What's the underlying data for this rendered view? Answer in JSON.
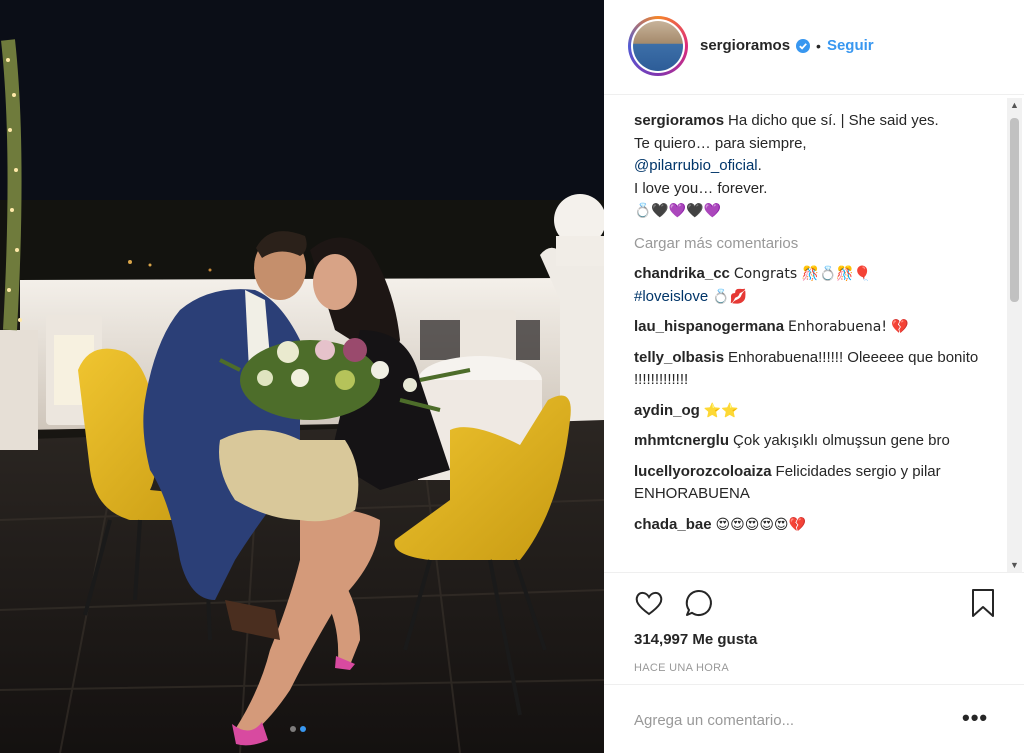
{
  "header": {
    "username": "sergioramos",
    "separator": "•",
    "follow_label": "Seguir",
    "avatar_icon": "profile-avatar",
    "verified_icon": "verified-badge-icon"
  },
  "caption": {
    "username": "sergioramos",
    "line1": "Ha dicho que sí. | She said yes.",
    "line2": "Te quiero… para siempre,",
    "mention": "@pilarrubio_oficial",
    "line3_end": ".",
    "line4": "I love you… forever.",
    "emojis": "💍🖤💜🖤💜"
  },
  "load_more": "Cargar más comentarios",
  "comments": [
    {
      "user": "chandrika_cc",
      "text": "Congrats 🎊💍🎊🎈",
      "hashtag": "#loveislove",
      "suffix": "💍💋"
    },
    {
      "user": "lau_hispanogermana",
      "text": "Enhorabuena! 💔"
    },
    {
      "user": "telly_olbasis",
      "text": "Enhorabuena!!!!!! Oleeeee que bonito !!!!!!!!!!!!!"
    },
    {
      "user": "aydin_og",
      "text": "⭐⭐"
    },
    {
      "user": "mhmtcnerglu",
      "text": "Çok yakışıklı olmuşsun gene bro"
    },
    {
      "user": "lucellyorozcoloaiza",
      "text": "Felicidades sergio y pilar ENHORABUENA"
    },
    {
      "user": "chada_bae",
      "text": "😍😍😍😍😍💔"
    }
  ],
  "actions": {
    "like_icon": "heart-icon",
    "comment_icon": "comment-bubble-icon",
    "save_icon": "bookmark-icon",
    "likes_text": "314,997 Me gusta",
    "timestamp": "HACE UNA HORA"
  },
  "add_comment": {
    "placeholder": "Agrega un comentario...",
    "more_label": "•••"
  },
  "carousel": {
    "total": 2,
    "active": 1
  },
  "colors": {
    "link_blue": "#3897f0",
    "mention_blue": "#003569",
    "muted_gray": "#999999",
    "chair_yellow": "#e8b820"
  }
}
